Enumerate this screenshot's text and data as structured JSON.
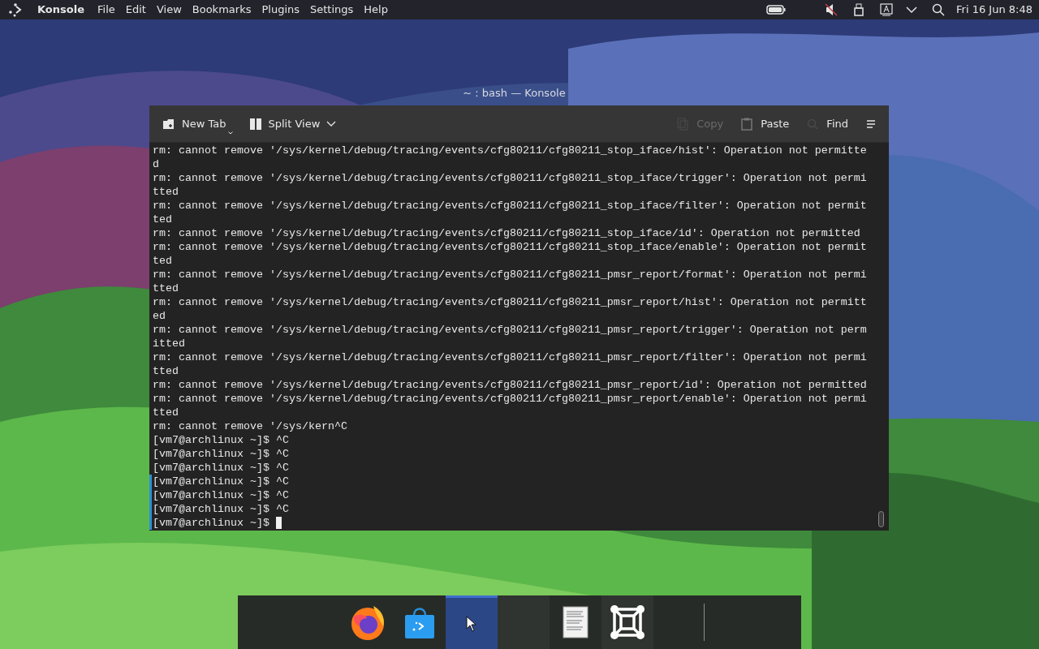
{
  "top_panel": {
    "app_name": "Konsole",
    "menu": [
      "File",
      "Edit",
      "View",
      "Bookmarks",
      "Plugins",
      "Settings",
      "Help"
    ],
    "clock": "Fri 16 Jun 8:48"
  },
  "window": {
    "title": "~ : bash — Konsole"
  },
  "toolbar": {
    "left": [
      {
        "label": "New Tab",
        "kind": "new-tab",
        "disabled": false
      },
      {
        "label": "Split View",
        "kind": "split",
        "disabled": false
      }
    ],
    "right": [
      {
        "label": "Copy",
        "kind": "copy",
        "disabled": true
      },
      {
        "label": "Paste",
        "kind": "paste",
        "disabled": false
      },
      {
        "label": "Find",
        "kind": "find",
        "disabled": false
      }
    ]
  },
  "terminal": {
    "lines": [
      {
        "text": "rm: cannot remove '/sys/kernel/debug/tracing/events/cfg80211/cfg80211_stop_iface/hist': Operation not permitte",
        "marked": false
      },
      {
        "text": "d",
        "marked": false
      },
      {
        "text": "rm: cannot remove '/sys/kernel/debug/tracing/events/cfg80211/cfg80211_stop_iface/trigger': Operation not permi",
        "marked": false
      },
      {
        "text": "tted",
        "marked": false
      },
      {
        "text": "rm: cannot remove '/sys/kernel/debug/tracing/events/cfg80211/cfg80211_stop_iface/filter': Operation not permit",
        "marked": false
      },
      {
        "text": "ted",
        "marked": false
      },
      {
        "text": "rm: cannot remove '/sys/kernel/debug/tracing/events/cfg80211/cfg80211_stop_iface/id': Operation not permitted",
        "marked": false
      },
      {
        "text": "rm: cannot remove '/sys/kernel/debug/tracing/events/cfg80211/cfg80211_stop_iface/enable': Operation not permit",
        "marked": false
      },
      {
        "text": "ted",
        "marked": false
      },
      {
        "text": "rm: cannot remove '/sys/kernel/debug/tracing/events/cfg80211/cfg80211_pmsr_report/format': Operation not permi",
        "marked": false
      },
      {
        "text": "tted",
        "marked": false
      },
      {
        "text": "rm: cannot remove '/sys/kernel/debug/tracing/events/cfg80211/cfg80211_pmsr_report/hist': Operation not permitt",
        "marked": false
      },
      {
        "text": "ed",
        "marked": false
      },
      {
        "text": "rm: cannot remove '/sys/kernel/debug/tracing/events/cfg80211/cfg80211_pmsr_report/trigger': Operation not perm",
        "marked": false
      },
      {
        "text": "itted",
        "marked": false
      },
      {
        "text": "rm: cannot remove '/sys/kernel/debug/tracing/events/cfg80211/cfg80211_pmsr_report/filter': Operation not permi",
        "marked": false
      },
      {
        "text": "tted",
        "marked": false
      },
      {
        "text": "rm: cannot remove '/sys/kernel/debug/tracing/events/cfg80211/cfg80211_pmsr_report/id': Operation not permitted",
        "marked": false
      },
      {
        "text": "rm: cannot remove '/sys/kernel/debug/tracing/events/cfg80211/cfg80211_pmsr_report/enable': Operation not permi",
        "marked": false
      },
      {
        "text": "tted",
        "marked": false
      },
      {
        "text": "rm: cannot remove '/sys/kern^C",
        "marked": false
      },
      {
        "text": "[vm7@archlinux ~]$ ^C",
        "marked": false
      },
      {
        "text": "[vm7@archlinux ~]$ ^C",
        "marked": false
      },
      {
        "text": "[vm7@archlinux ~]$ ^C",
        "marked": false
      },
      {
        "text": "[vm7@archlinux ~]$ ^C",
        "marked": true
      },
      {
        "text": "[vm7@archlinux ~]$ ^C",
        "marked": true
      },
      {
        "text": "[vm7@archlinux ~]$ ^C",
        "marked": true
      },
      {
        "text": "[vm7@archlinux ~]$ ",
        "marked": true
      }
    ],
    "cursor": true
  },
  "dock": {
    "items": [
      {
        "kind": "browser",
        "selected": false
      },
      {
        "kind": "store",
        "selected": false
      },
      {
        "kind": "pointer",
        "selected": true
      },
      {
        "kind": "empty",
        "selected": false
      },
      {
        "kind": "document",
        "selected": false
      },
      {
        "kind": "frame",
        "selected": false
      }
    ]
  }
}
